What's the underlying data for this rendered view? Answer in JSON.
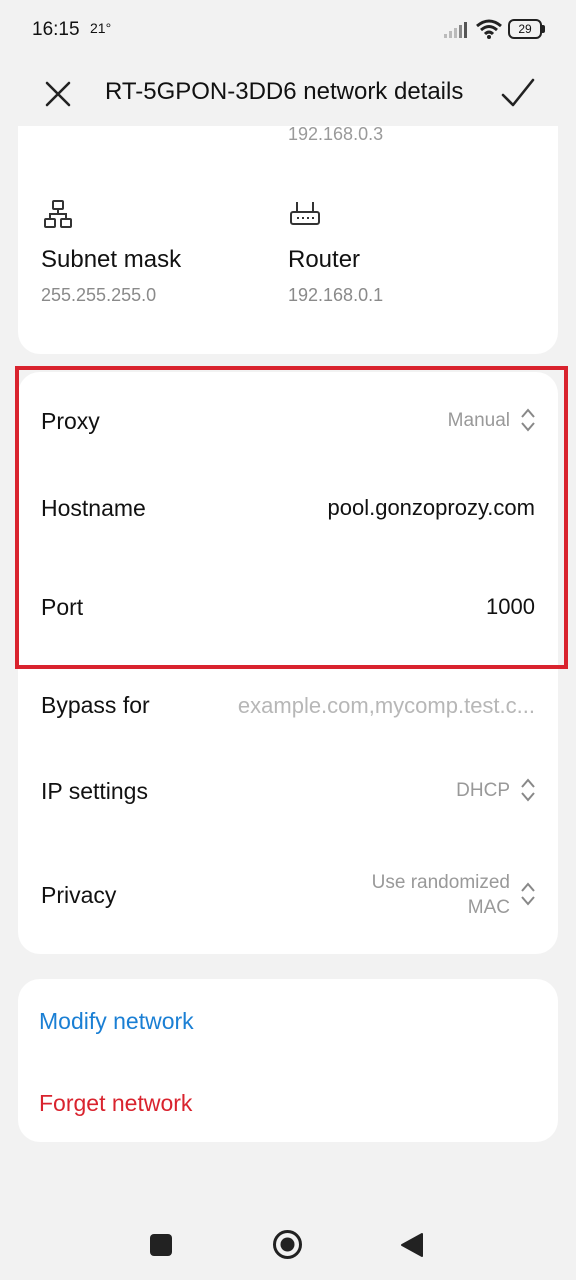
{
  "status_bar": {
    "time": "16:15",
    "temperature": "21°",
    "battery": "29",
    "icons": [
      "signal-icon",
      "wifi-icon",
      "battery-icon"
    ]
  },
  "header": {
    "title": "RT-5GPON-3DD6 network details",
    "close_icon": "close-icon",
    "confirm_icon": "checkmark-icon"
  },
  "ip_card": {
    "partial_ip": "192.168.0.3",
    "subnet": {
      "icon": "network-tree-icon",
      "label": "Subnet mask",
      "value": "255.255.255.0"
    },
    "router": {
      "icon": "router-icon",
      "label": "Router",
      "value": "192.168.0.1"
    }
  },
  "settings": {
    "proxy": {
      "label": "Proxy",
      "value": "Manual"
    },
    "hostname": {
      "label": "Hostname",
      "value": "pool.gonzoprozy.com"
    },
    "port": {
      "label": "Port",
      "value": "1000"
    },
    "bypass": {
      "label": "Bypass for",
      "placeholder": "example.com,mycomp.test.c..."
    },
    "ip_settings": {
      "label": "IP settings",
      "value": "DHCP"
    },
    "privacy": {
      "label": "Privacy",
      "value_line1": "Use randomized",
      "value_line2": "MAC"
    }
  },
  "actions": {
    "modify": "Modify network",
    "forget": "Forget network"
  },
  "colors": {
    "accent_blue": "#1a7fd4",
    "danger_red": "#d9232e",
    "highlight": "#d9232e"
  },
  "nav": {
    "icons": [
      "recents-square-icon",
      "home-circle-icon",
      "back-triangle-icon"
    ]
  }
}
